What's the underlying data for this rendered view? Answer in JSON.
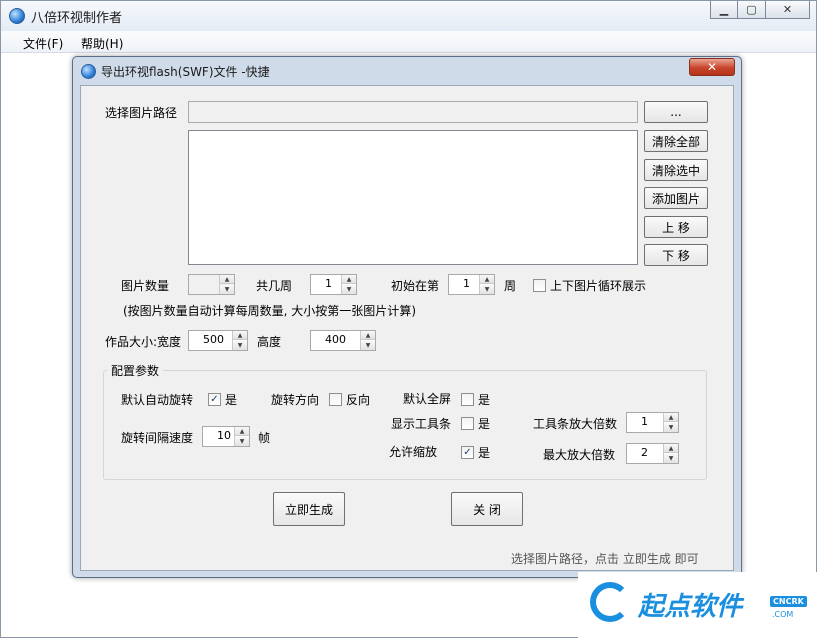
{
  "app": {
    "title": "八倍环视制作者"
  },
  "menu": [
    {
      "label": "文件(F)"
    },
    {
      "label": "帮助(H)"
    }
  ],
  "dialog": {
    "title": "导出环视flash(SWF)文件 -快捷",
    "close_label": "✕",
    "path_label": "选择图片路径",
    "path_value": "",
    "browse_label": "...",
    "buttons": {
      "clear_all": "清除全部",
      "clear_selected": "清除选中",
      "add_image": "添加图片",
      "move_up": "上 移",
      "move_down": "下 移"
    },
    "image_count_label": "图片数量",
    "image_count_value": "",
    "weeks_label": "共几周",
    "weeks_value": "1",
    "start_label": "初始在第",
    "start_value": "1",
    "week_unit": "周",
    "loop_label": "上下图片循环展示",
    "loop_checked": false,
    "note": "(按图片数量自动计算每周数量, 大小按第一张图片计算)",
    "size_label": "作品大小:宽度",
    "width_value": "500",
    "height_label": "高度",
    "height_value": "400",
    "config": {
      "title": "配置参数",
      "auto_rotate_label": "默认自动旋转",
      "auto_rotate_checked": true,
      "auto_rotate_yes": "是",
      "direction_label": "旋转方向",
      "reverse_checked": false,
      "reverse_label": "反向",
      "fullscreen_label": "默认全屏",
      "fullscreen_checked": false,
      "fullscreen_yes": "是",
      "toolbar_label": "显示工具条",
      "toolbar_checked": false,
      "toolbar_yes": "是",
      "toolbar_zoom_label": "工具条放大倍数",
      "toolbar_zoom_value": "1",
      "interval_label": "旋转间隔速度",
      "interval_value": "10",
      "frame_unit": "帧",
      "allow_zoom_label": "允许缩放",
      "allow_zoom_checked": true,
      "allow_zoom_yes": "是",
      "max_zoom_label": "最大放大倍数",
      "max_zoom_value": "2"
    },
    "generate_label": "立即生成",
    "close_button_label": "关 闭",
    "status": "选择图片路径，点击 立即生成 即可"
  },
  "watermark": {
    "text": "起点软件",
    "tag": "CNCRK",
    "domain": ".COM"
  }
}
